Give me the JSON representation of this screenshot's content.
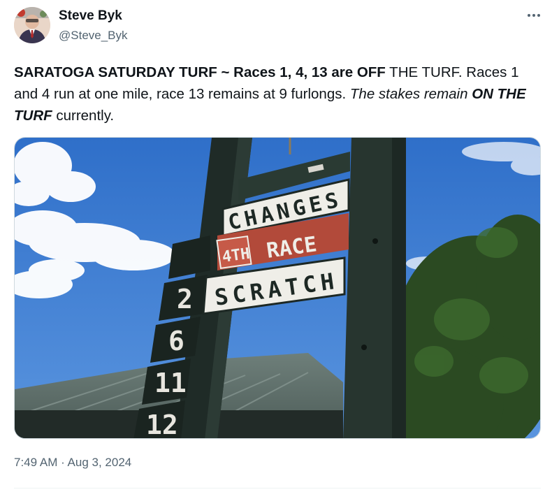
{
  "author": {
    "name": "Steve Byk",
    "handle": "@Steve_Byk"
  },
  "tweet": {
    "seg1": "SARATOGA SATURDAY TURF ~ Races 1, 4, 13 are OFF",
    "seg2": " THE TURF. Races 1 and 4 run at one mile, race 13 remains at 9 furlongs. ",
    "seg3": "The stakes remain ",
    "seg4": "ON THE TURF",
    "seg5": " currently."
  },
  "media": {
    "sign_changes": "CHANGES",
    "sign_race_number": "4TH",
    "sign_race": "RACE",
    "sign_scratch": "SCRATCH",
    "board_numbers": [
      "2",
      "6",
      "11",
      "12"
    ]
  },
  "timestamp": "7:49 AM · Aug 3, 2024"
}
